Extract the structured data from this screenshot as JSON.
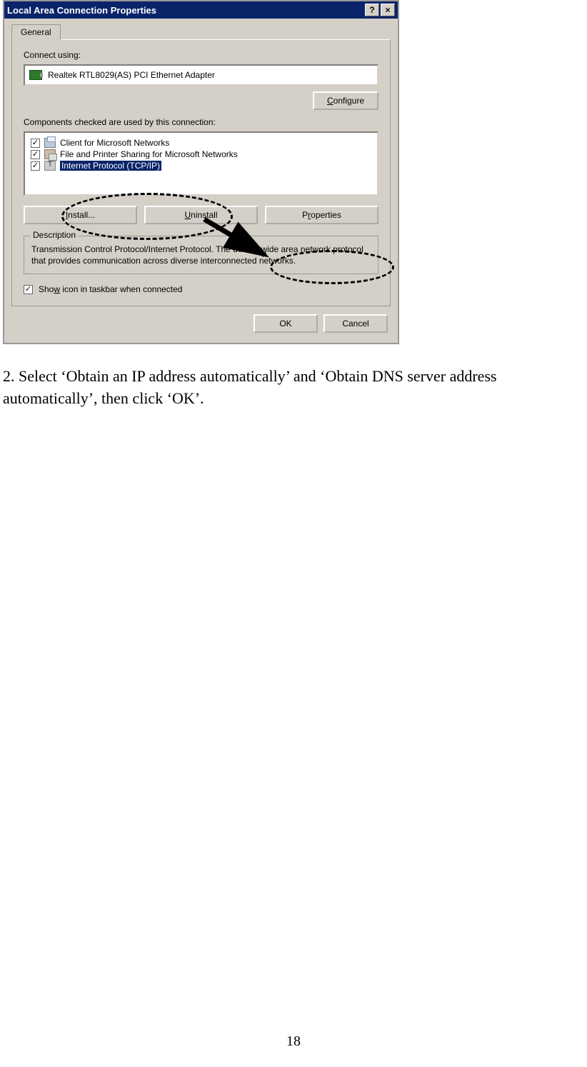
{
  "dialog": {
    "title": "Local Area Connection Properties",
    "help": "?",
    "close": "×",
    "tab": "General",
    "connect_using_label": "Connect using:",
    "adapter": "Realtek RTL8029(AS) PCI Ethernet Adapter",
    "configure": "Configure",
    "components_label": "Components checked are used by this connection:",
    "components": [
      {
        "label": "Client for Microsoft Networks",
        "selected": false
      },
      {
        "label": "File and Printer Sharing for Microsoft Networks",
        "selected": false
      },
      {
        "label": "Internet Protocol (TCP/IP)",
        "selected": true
      }
    ],
    "install": "Install...",
    "uninstall": "Uninstall",
    "properties": "Properties",
    "description_label": "Description",
    "description_text": "Transmission Control Protocol/Internet Protocol. The default wide area network protocol that provides communication across diverse interconnected networks.",
    "show_icon": "Show icon in taskbar when connected",
    "ok": "OK",
    "cancel": "Cancel"
  },
  "instruction": "2. Select ‘Obtain an IP address automatically’ and ‘Obtain DNS server address automatically’, then click ‘OK’.",
  "page_number": "18"
}
